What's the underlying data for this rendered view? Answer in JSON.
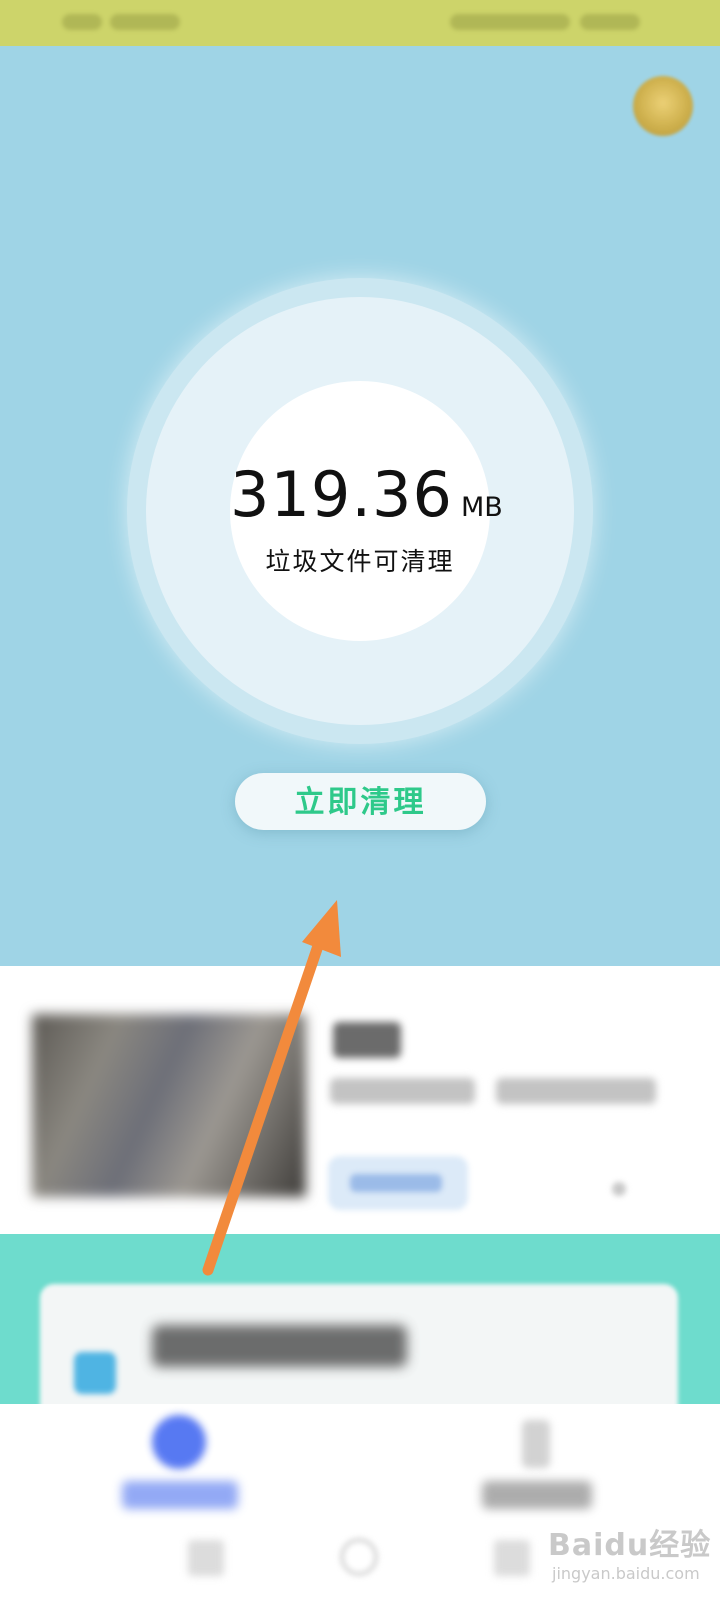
{
  "cleaner": {
    "size_value": "319.36",
    "size_unit": "MB",
    "size_label": "垃圾文件可清理",
    "clean_button": "立即清理"
  },
  "watermark": {
    "main": "Baidu经验",
    "sub": "jingyan.baidu.com"
  },
  "colors": {
    "hero_bg": "#9fd4e6",
    "status_bar": "#cdd46a",
    "clean_text": "#2ec98a",
    "annotation_arrow": "#f28a3c",
    "teal_band": "#6edccd",
    "nav_active": "#4f72f2"
  },
  "icons": {
    "avatar": "avatar-icon",
    "annotation": "arrow-icon"
  }
}
